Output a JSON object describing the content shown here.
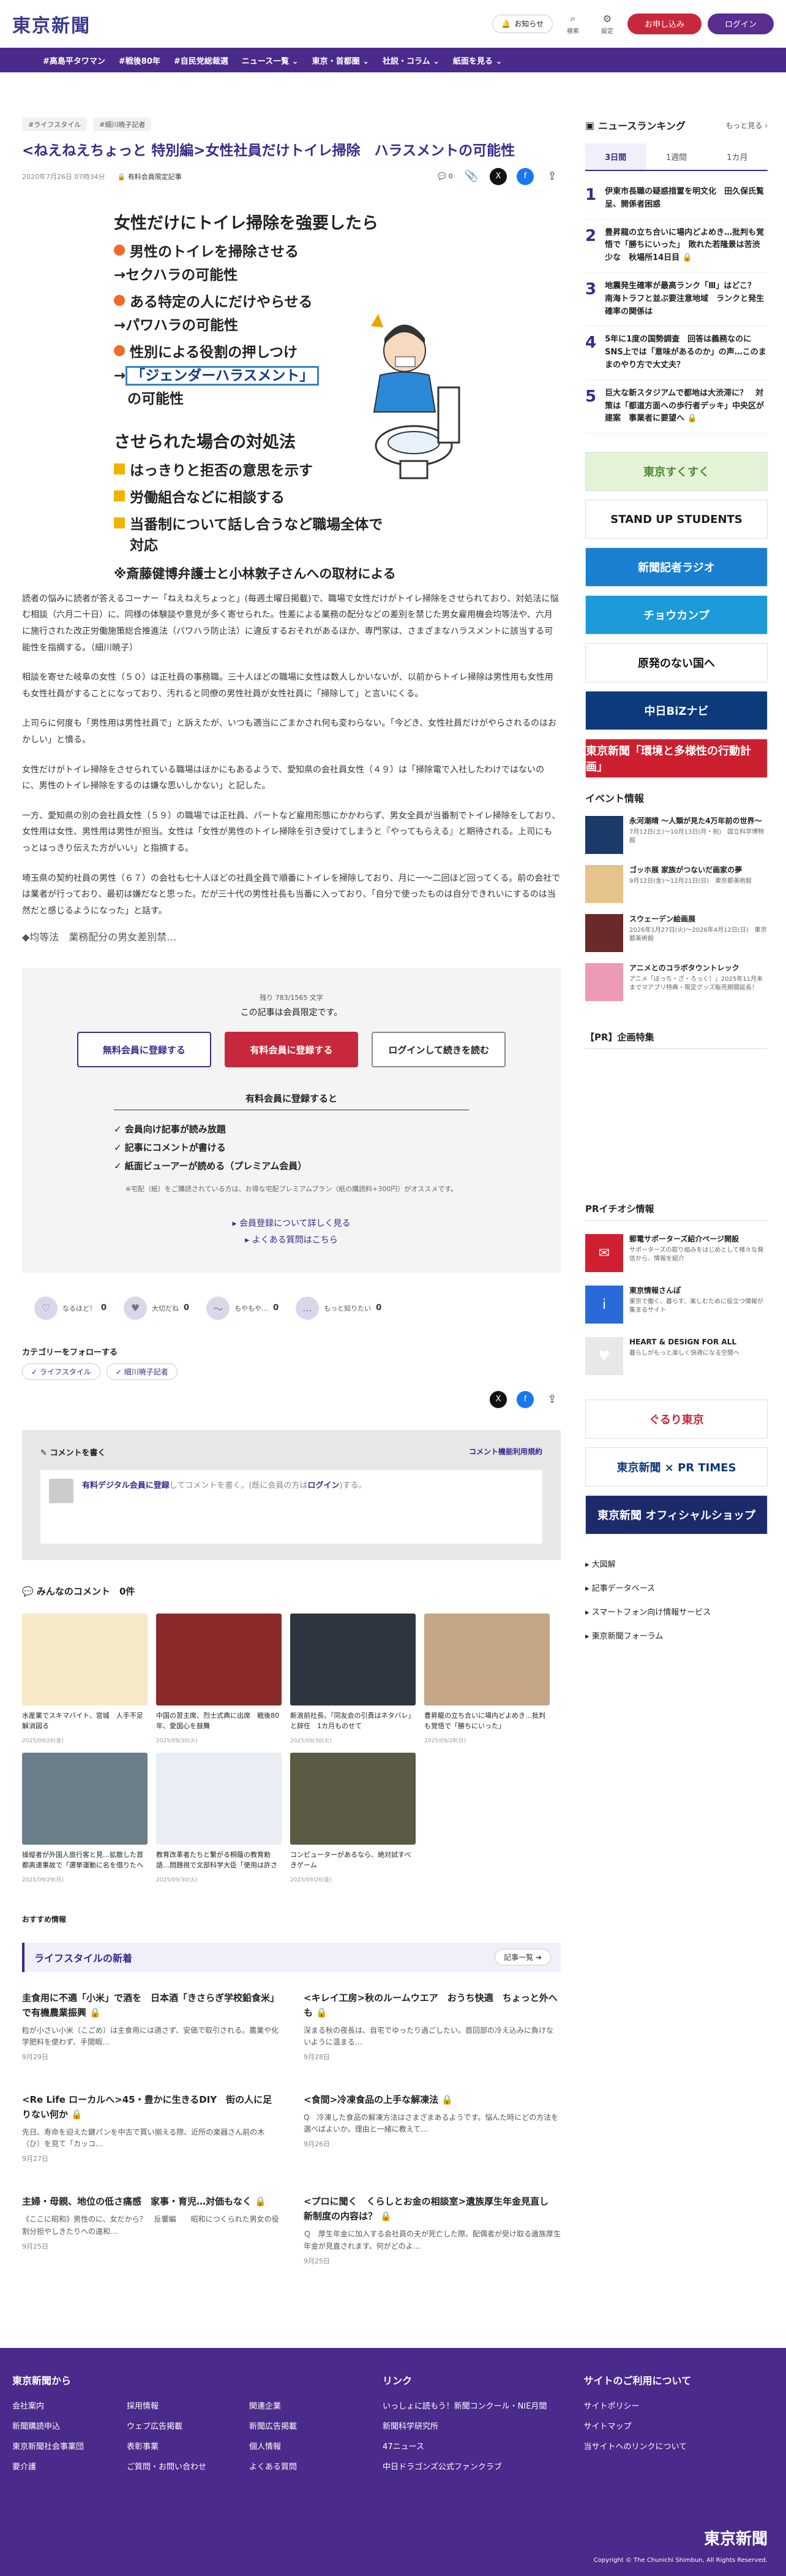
{
  "site": {
    "logo": "東京新聞"
  },
  "header": {
    "notify": "お知らせ",
    "search": "検索",
    "settings": "設定",
    "register": "お申し込み",
    "login": "ログイン"
  },
  "nav": [
    "#高島平タワマン",
    "#戦後80年",
    "#自民党総裁選",
    "ニュース一覧 ⌄",
    "東京・首都圏 ⌄",
    "社説・コラム ⌄",
    "紙面を見る ⌄"
  ],
  "article": {
    "tags": [
      "#ライフスタイル",
      "#細川暁子記者"
    ],
    "title": "<ねえねえちょっと 特別編>女性社員だけトイレ掃除　ハラスメントの可能性",
    "date": "2020年7月26日 07時34分",
    "lock": "有料会員限定記事",
    "comment_count": "0",
    "ig": {
      "title": "女性だけにトイレ掃除を強要したら",
      "i1": "男性のトイレを掃除させる",
      "r1": "→セクハラの可能性",
      "i2": "ある特定の人にだけやらせる",
      "r2": "→パワハラの可能性",
      "i3": "性別による役割の押しつけ",
      "r3a": "→",
      "r3b": "「ジェンダーハラスメント」",
      "r3c": "の可能性",
      "title2": "させられた場合の対処法",
      "c1": "はっきりと拒否の意思を示す",
      "c2": "労働組合などに相談する",
      "c3": "当番制について話し合うなど職場全体で",
      "c4": "対応",
      "note": "※斎藤健博弁護士と小林敦子さんへの取材による"
    },
    "paras": [
      "読者の悩みに読者が答えるコーナー「ねえねえちょっと」(毎週土曜日掲載)で、職場で女性だけがトイレ掃除をさせられており、対処法に悩む相談（六月二十日）に、同様の体験談や意見が多く寄せられた。性差による業務の配分などの差別を禁じた男女雇用機会均等法や、六月に施行された改正労働施策総合推進法（パワハラ防止法）に違反するおそれがあるほか、専門家は、さまざまなハラスメントに該当する可能性を指摘する。（細川暁子）",
      "相談を寄せた岐阜の女性（５０）は正社員の事務職。三十人ほどの職場に女性は数人しかいないが、以前からトイレ掃除は男性用も女性用も女性社員がすることになっており、汚れると同僚の男性社員が女性社員に「掃除して」と言いにくる。",
      "上司らに何度も「男性用は男性社員で」と訴えたが、いつも適当にごまかされ何も変わらない。「今どき、女性社員だけがやらされるのはおかしい」と憤る。",
      "女性だけがトイレ掃除をさせられている職場はほかにもあるようで、愛知県の会社員女性（４９）は「掃除電で入社したわけではないのに、男性のトイレ掃除をするのは嫌な思いしかない」と記した。",
      "一方、愛知県の別の会社員女性（５９）の職場では正社員、パートなど雇用形態にかかわらず、男女全員が当番制でトイレ掃除をしており、女性用は女性、男性用は男性が担当。女性は「女性が男性のトイレ掃除を引き受けてしまうと『やってもらえる』と期待される。上司にもっとはっきり伝えた方がいい」と指摘する。",
      "埼玉県の契約社員の男性（６７）の会社も七十人ほどの社員全員で順番にトイレを掃除しており、月に一～二回ほど回ってくる。前の会社では業者が行っており、最初は嫌だなと思った。だが三十代の男性社長も当番に入っており、「自分で使ったものは自分できれいにするのは当然だと感じるようになった」と話す。"
    ],
    "subhead": "◆均等法　業務配分の男女差別禁…"
  },
  "paywall": {
    "count": "残り 783/1565 文字",
    "msg": "この記事は会員限定です。",
    "free": "無料会員に登録する",
    "paid": "有料会員に登録する",
    "login": "ログインして続きを読む",
    "benefit_title": "有料会員に登録すると",
    "benefits": [
      "✓ 会員向け記事が読み放題",
      "✓ 記事にコメントが書ける",
      "✓ 紙面ビューアーが読める（プレミアム会員）"
    ],
    "note": "※宅配（紙）をご購読されている方は、お得な宅配プレミアムプラン（紙の購読料+300円）がオススメです。",
    "link1": "▸ 会員登録について詳しく見る",
    "link2": "▸ よくある質問はこちら"
  },
  "reactions": [
    {
      "label": "なるほど！",
      "count": "0",
      "icon": "♡"
    },
    {
      "label": "大切だね",
      "count": "0",
      "icon": "♥"
    },
    {
      "label": "もやもや…",
      "count": "0",
      "icon": "〜"
    },
    {
      "label": "もっと知りたい",
      "count": "0",
      "icon": "…"
    }
  ],
  "follow": {
    "title": "カテゴリーをフォローする",
    "tags": [
      "✓ ライフスタイル",
      "✓ 細川暁子記者"
    ]
  },
  "comment": {
    "title": "コメントを書く",
    "rule": "コメント機能利用規約",
    "link": "有料デジタル会員に登録",
    "text": "してコメントを書く。(既に会員の方は",
    "login": "ログイン",
    "tail": ")する。"
  },
  "everyone": {
    "title": "みんなのコメント",
    "count": "0件"
  },
  "cards": [
    {
      "t": "水産業でスキマバイト、宮城　人手不足解消図る",
      "d": "2025/09/26(金)",
      "c": "#f5e9c8"
    },
    {
      "t": "中国の習主席、烈士式典に出席　戦後80年、愛国心を鼓舞",
      "d": "2025/09/30(火)",
      "c": "#8a2a2a"
    },
    {
      "t": "新浪前社長、「同友会の引責はネタバレ」と辞任　1カ月ものせて",
      "d": "2025/09/30(火)",
      "c": "#2d3540"
    },
    {
      "t": "豊昇龍の立ち合いに場内どよめき…批判も覚悟で「勝ちにいった」",
      "d": "2025/09/28(日)",
      "c": "#c4a585"
    },
    {
      "t": "操縦者が外国人旅行客と見…拡散した首都高速事故で「選挙運動に名を借りたヘイト」の異様…",
      "d": "2025/09/29(月)",
      "c": "#6b7e8a"
    },
    {
      "t": "教育改革者たちと繋がる桐蔭の教育勅語…問題視で文部科学大臣「使用は許されない」",
      "d": "2025/09/30(火)",
      "c": "#e8eef3"
    },
    {
      "t": "コンピューターがあるなら、絶対試すべきゲーム",
      "d": "2025/09/26(金)",
      "c": "#5b5a45"
    }
  ],
  "recommend": "おすすめ情報",
  "lifestyle": {
    "title": "ライフスタイルの新着",
    "all": "記事一覧 ➔",
    "items": [
      {
        "t": "圭食用に不適「小米」で酒を　日本酒「きさらぎ学校鉛食米」で有機農業振興 🔒",
        "s": "粒が小さい小米（こごめ）は主食用には適さず、安価で取引される。農業や化学肥料を使わず、手間暇…",
        "d": "9月29日"
      },
      {
        "t": "<キレイ工房>秋のルームウエア　おうち快適　ちょっと外へも 🔒",
        "s": "深まる秋の夜長は、自宅でゆったり過ごしたい。首回部の冷え込みに負けないように温まる…",
        "d": "9月28日"
      },
      {
        "t": "<Re Life ローカルへ>45・豊かに生きるDIY　街の人に足りない何か 🔒",
        "s": "先日、寿命を迎えた鍵パンを中古で買い揃える際、近所の楽器さん前の木（ひ）を見て「カッコ…",
        "d": "9月27日"
      },
      {
        "t": "<食間>冷凍食品の上手な解凍法 🔒",
        "s": "Q　冷凍した食品の解凍方法はさまざまあるようです。悩んた時にどの方法を選べばよいか。理由と一緒に教えて…",
        "d": "9月26日"
      },
      {
        "t": "主婦・母親、地位の低さ痛感　家事・育児…対価もなく 🔒",
        "s": "《ここに昭和》男性のに、女だから？　反響編　　昭和につくられた男女の役割分担やしきたりへの違和…",
        "d": "9月25日"
      },
      {
        "t": "<プロに聞く　くらしとお金の相談室>遺族厚生年金見直し　新制度の内容は？ 🔒",
        "s": "Ｑ　厚生年金に加入する会社員の夫が死亡した際、配偶者が受け取る遺族厚生年金が見直されます。何がどのよ…",
        "d": "9月25日"
      }
    ]
  },
  "side": {
    "ranking_title": "ニュースランキング",
    "more": "もっと見る ›",
    "tabs": [
      "3日間",
      "1週間",
      "1カ月"
    ],
    "ranks": [
      {
        "n": "1",
        "t": "伊東市長職の疑惑措置を明文化　田久保氏覧呈、開係者困惑"
      },
      {
        "n": "2",
        "t": "豊昇龍の立ち合いに場内どよめき…批判も覚悟で「勝ちにいった」　敗れた若隆景は苦渋少な　秋場所14日目 🔒"
      },
      {
        "n": "3",
        "t": "地震発生確率が最高ランク「Ⅲ」はどこ？　南海トラフと並ぶ要注意地域　ランクと発生確率の関係は"
      },
      {
        "n": "4",
        "t": "5年に1度の国勢調査　回答は義務なのにSNS上では「意味があるのか」の声…このままのやり方で大丈夫？"
      },
      {
        "n": "5",
        "t": "巨大な新スタジアムで都地は大渋滞に？　対策は「都道方面への歩行者デッキ」中央区が建案　事業者に要望へ 🔒"
      }
    ],
    "banners": [
      {
        "t": "東京すくすく",
        "bg": "#e4f2d7",
        "fg": "#4a8a2a"
      },
      {
        "t": "STAND UP STUDENTS",
        "bg": "#ffffff",
        "fg": "#1b1b1b"
      },
      {
        "t": "新聞記者ラジオ",
        "bg": "#1a7fd1",
        "fg": "#ffffff"
      },
      {
        "t": "チョウカンプ",
        "bg": "#1c9ad9",
        "fg": "#ffffff"
      },
      {
        "t": "原発のない国へ",
        "bg": "#ffffff",
        "fg": "#111111"
      },
      {
        "t": "中日BiZナビ",
        "bg": "#0c3a7a",
        "fg": "#ffffff"
      },
      {
        "t": "東京新聞「環境と多様性の行動計画」",
        "bg": "#cc2030",
        "fg": "#ffffff"
      }
    ],
    "events_title": "イベント情報",
    "events": [
      {
        "t": "永河潮晴 〜人類が見た4万年前の世界〜",
        "s": "7月12日(土)〜10月13日(月・祝)　国立科学博物館",
        "c": "#1b3a6a"
      },
      {
        "t": "ゴッホ展 家族がつないだ画家の夢",
        "s": "9月12日(金)〜12月21日(日)　東京都美術館",
        "c": "#e6c38a"
      },
      {
        "t": "スウェーデン絵画展",
        "s": "2026年1月27日(火)〜2026年4月12日(日)　東京都美術館",
        "c": "#6a2a2a"
      },
      {
        "t": "アニメとのコラボタウントレック",
        "s": "アニメ「ぼっち・ざ・ろっく！」2025年11月未までマアプリ特典・限定グッズ販売期間延長！",
        "c": "#ec9ab5"
      }
    ],
    "pr_title": "【PR】企画特集",
    "pr2_title": "PRイチオシ情報",
    "pr": [
      {
        "t": "郵電サポーターズ紹介ページ開設",
        "s": "サポーターズの取り組みをはじめとして様々な発信から、情報を紹介",
        "c": "#d02030",
        "i": "✉"
      },
      {
        "t": "東京情報さんぽ",
        "s": "東京で働く、暮らす、楽しむために役立つ情報が集まるサイト",
        "c": "#2a6ad8",
        "i": "i"
      },
      {
        "t": "HEART & DESIGN FOR ALL",
        "s": "暮らしがもっと楽しく快適になる空間へ",
        "c": "#e8e8e8",
        "i": "♥"
      }
    ],
    "banners2": [
      {
        "t": "ぐるり東京",
        "bg": "#ffffff",
        "fg": "#c8283c"
      },
      {
        "t": "東京新聞 × PR TIMES",
        "bg": "#ffffff",
        "fg": "#0c3a7a"
      },
      {
        "t": "東京新聞 オフィシャルショップ",
        "bg": "#1c2a6a",
        "fg": "#ffffff"
      }
    ],
    "links": [
      "▸ 大図解",
      "▸ 記事データベース",
      "▸ スマートフォン向け情報サービス",
      "▸ 東京新聞フォーラム"
    ]
  },
  "footer": {
    "c1": {
      "h": "東京新聞から",
      "items": [
        "会社案内",
        "新聞購読申込",
        "東京新聞社会事業団",
        "要介護",
        "採用情報",
        "ウェブ広告掲載",
        "表彰事業",
        "ご質問・お問い合わせ",
        "関連企業",
        "新聞広告掲載",
        "個人情報",
        "よくある質問"
      ]
    },
    "c2": {
      "h": "リンク",
      "items": [
        "いっしょに読もう！新聞コンクール・NIE月間",
        "新聞科学研究所",
        "47ニュース",
        "中日ドラゴンズ公式ファンクラブ"
      ]
    },
    "c3": {
      "h": "サイトのご利用について",
      "items": [
        "サイトポリシー",
        "サイトマップ",
        "当サイトへのリンクについて"
      ]
    },
    "logo": "東京新聞",
    "copy": "Copyright © The Chunichi Shimbun, All Rights Reserved."
  }
}
